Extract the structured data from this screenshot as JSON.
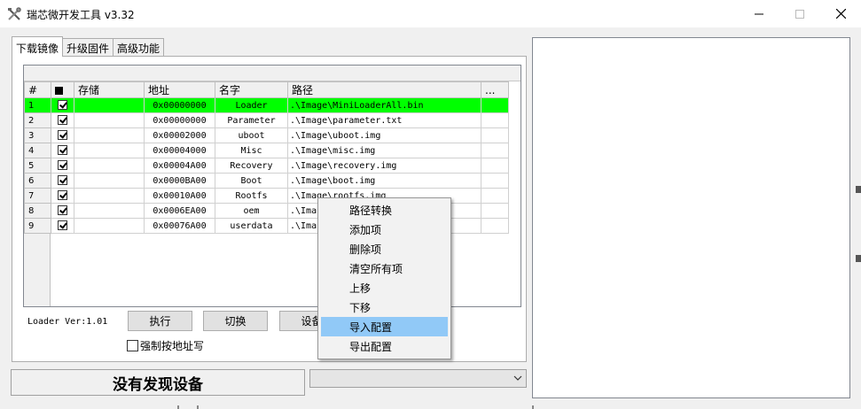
{
  "window": {
    "title": "瑞芯微开发工具 v3.32",
    "minimize_icon": "minimize-icon",
    "maximize_icon": "maximize-icon",
    "close_icon": "close-icon"
  },
  "tabs": [
    {
      "label": "下载镜像",
      "active": true
    },
    {
      "label": "升级固件",
      "active": false
    },
    {
      "label": "高级功能",
      "active": false
    }
  ],
  "grid": {
    "columns": [
      "#",
      "",
      "存储",
      "地址",
      "名字",
      "路径",
      "..."
    ],
    "rows": [
      {
        "num": "1",
        "checked": true,
        "storage": "",
        "address": "0x00000000",
        "name": "Loader",
        "path": ".\\Image\\MiniLoaderAll.bin",
        "selected": true
      },
      {
        "num": "2",
        "checked": true,
        "storage": "",
        "address": "0x00000000",
        "name": "Parameter",
        "path": ".\\Image\\parameter.txt",
        "selected": false
      },
      {
        "num": "3",
        "checked": true,
        "storage": "",
        "address": "0x00002000",
        "name": "uboot",
        "path": ".\\Image\\uboot.img",
        "selected": false
      },
      {
        "num": "4",
        "checked": true,
        "storage": "",
        "address": "0x00004000",
        "name": "Misc",
        "path": ".\\Image\\misc.img",
        "selected": false
      },
      {
        "num": "5",
        "checked": true,
        "storage": "",
        "address": "0x00004A00",
        "name": "Recovery",
        "path": ".\\Image\\recovery.img",
        "selected": false
      },
      {
        "num": "6",
        "checked": true,
        "storage": "",
        "address": "0x0000BA00",
        "name": "Boot",
        "path": ".\\Image\\boot.img",
        "selected": false
      },
      {
        "num": "7",
        "checked": true,
        "storage": "",
        "address": "0x00010A00",
        "name": "Rootfs",
        "path": ".\\Image\\rootfs.img",
        "selected": false
      },
      {
        "num": "8",
        "checked": true,
        "storage": "",
        "address": "0x0006EA00",
        "name": "oem",
        "path": ".\\Ima",
        "selected": false
      },
      {
        "num": "9",
        "checked": true,
        "storage": "",
        "address": "0x00076A00",
        "name": "userdata",
        "path": ".\\Ima",
        "selected": false
      }
    ]
  },
  "controls": {
    "loader_version": "Loader Ver:1.01",
    "execute_label": "执行",
    "switch_label": "切换",
    "device_label": "设备",
    "force_write_label": "强制按地址写"
  },
  "status": {
    "message": "没有发现设备",
    "combo_value": ""
  },
  "context_menu": {
    "items": [
      {
        "label": "路径转换",
        "highlight": false
      },
      {
        "label": "添加项",
        "highlight": false
      },
      {
        "label": "删除项",
        "highlight": false
      },
      {
        "label": "清空所有项",
        "highlight": false
      },
      {
        "label": "上移",
        "highlight": false
      },
      {
        "label": "下移",
        "highlight": false
      },
      {
        "label": "导入配置",
        "highlight": true
      },
      {
        "label": "导出配置",
        "highlight": false
      }
    ]
  },
  "colors": {
    "selected_row": "#00ff00",
    "menu_highlight": "#91c9f7"
  }
}
